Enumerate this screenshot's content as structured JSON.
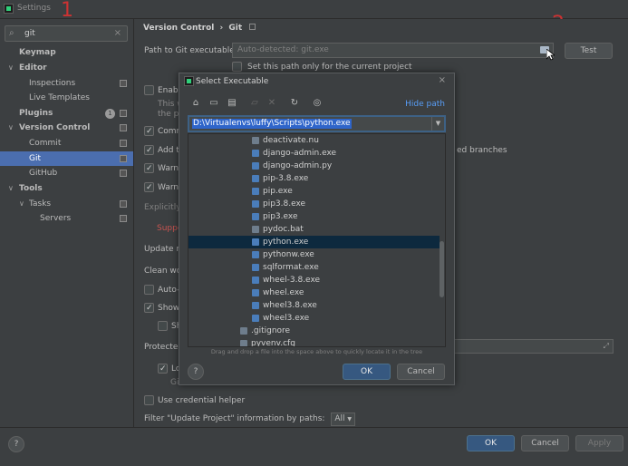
{
  "window": {
    "title": "Settings"
  },
  "markers": {
    "one": "1",
    "two": "2"
  },
  "search": {
    "value": "git",
    "icon": "search-icon",
    "clear": "×"
  },
  "sidebar": {
    "items": [
      {
        "label": "Keymap"
      },
      {
        "label": "Editor",
        "chevron": "∨"
      },
      {
        "label": "Inspections"
      },
      {
        "label": "Live Templates"
      },
      {
        "label": "Plugins",
        "badge": "1"
      },
      {
        "label": "Version Control",
        "chevron": "∨"
      },
      {
        "label": "Commit"
      },
      {
        "label": "Git"
      },
      {
        "label": "GitHub"
      },
      {
        "label": "Tools",
        "chevron": "∨"
      },
      {
        "label": "Tasks",
        "chevron": "∨"
      },
      {
        "label": "Servers"
      }
    ]
  },
  "main": {
    "breadcrumb": {
      "part1": "Version Control",
      "sep": "›",
      "part2": "Git"
    },
    "path_label": "Path to Git executable:",
    "path_placeholder": "Auto-detected: git.exe",
    "test_button": "Test",
    "set_path_only": "Set this path only for the current project",
    "rows": {
      "enable": "Enabl",
      "this_w": "This w",
      "the_pr": "the pr",
      "comm": "Comm",
      "add_t": "Add t",
      "add_t_rest": "ed branches",
      "warn1": "Warn",
      "warn2": "Warn",
      "explicitly": "Explicitly",
      "support": "Suppo",
      "update_m": "Update m",
      "clean_wo": "Clean wo",
      "auto": "Auto-",
      "show": "Show",
      "sh": "Sh",
      "protected": "Protected",
      "lo": "Lo",
      "gi": "Gi",
      "credential": "Use credential helper",
      "filter_label": "Filter \"Update Project\" information by paths:",
      "filter_value": "All"
    }
  },
  "footer": {
    "ok": "OK",
    "cancel": "Cancel",
    "apply": "Apply",
    "help": "?"
  },
  "dialog": {
    "title": "Select Executable",
    "close": "×",
    "hide_path": "Hide path",
    "path_value": "D:\\Virtualenvs\\luffy\\Scripts\\python.exe",
    "files": [
      {
        "name": "deactivate.nu",
        "kind": "file"
      },
      {
        "name": "django-admin.exe",
        "kind": "py"
      },
      {
        "name": "django-admin.py",
        "kind": "py"
      },
      {
        "name": "pip-3.8.exe",
        "kind": "py"
      },
      {
        "name": "pip.exe",
        "kind": "py"
      },
      {
        "name": "pip3.8.exe",
        "kind": "py"
      },
      {
        "name": "pip3.exe",
        "kind": "py"
      },
      {
        "name": "pydoc.bat",
        "kind": "file"
      },
      {
        "name": "python.exe",
        "kind": "py",
        "selected": true
      },
      {
        "name": "pythonw.exe",
        "kind": "py"
      },
      {
        "name": "sqlformat.exe",
        "kind": "py"
      },
      {
        "name": "wheel-3.8.exe",
        "kind": "py"
      },
      {
        "name": "wheel.exe",
        "kind": "py"
      },
      {
        "name": "wheel3.8.exe",
        "kind": "py"
      },
      {
        "name": "wheel3.exe",
        "kind": "py"
      },
      {
        "name": ".gitignore",
        "kind": "file"
      },
      {
        "name": "pyvenv.cfg",
        "kind": "file"
      }
    ],
    "hint": "Drag and drop a file into the space above to quickly locate it in the tree",
    "ok": "OK",
    "cancel": "Cancel",
    "help": "?"
  }
}
